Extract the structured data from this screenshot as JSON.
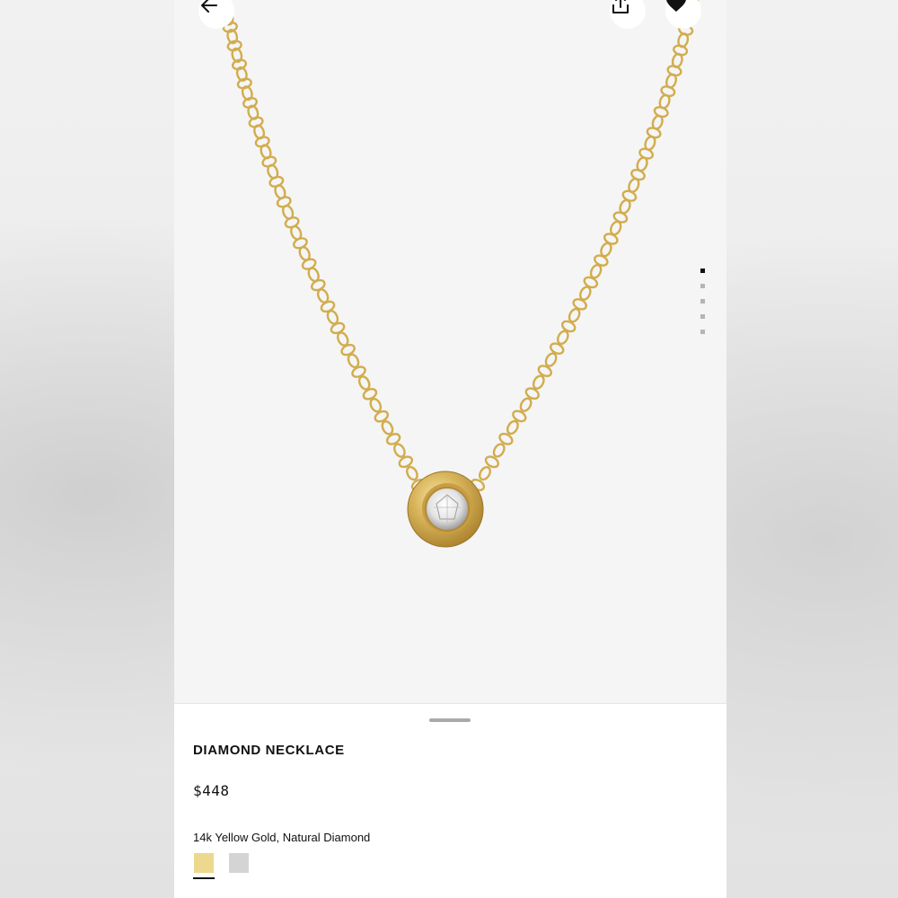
{
  "product": {
    "title": "DIAMOND NECKLACE",
    "price": "$448",
    "material": "14k Yellow Gold, Natural Diamond",
    "swatches": [
      {
        "name": "Yellow Gold",
        "color": "#ecd98d",
        "selected": true
      },
      {
        "name": "White Gold",
        "color": "#d4d4d4",
        "selected": false
      }
    ]
  },
  "gallery": {
    "image_count": 5,
    "active_index": 0
  },
  "colors": {
    "gold": "#d2ad4e",
    "accent": "#111111"
  },
  "icons": {
    "back": "arrow-left-icon",
    "share": "share-icon",
    "favorite": "heart-icon"
  }
}
